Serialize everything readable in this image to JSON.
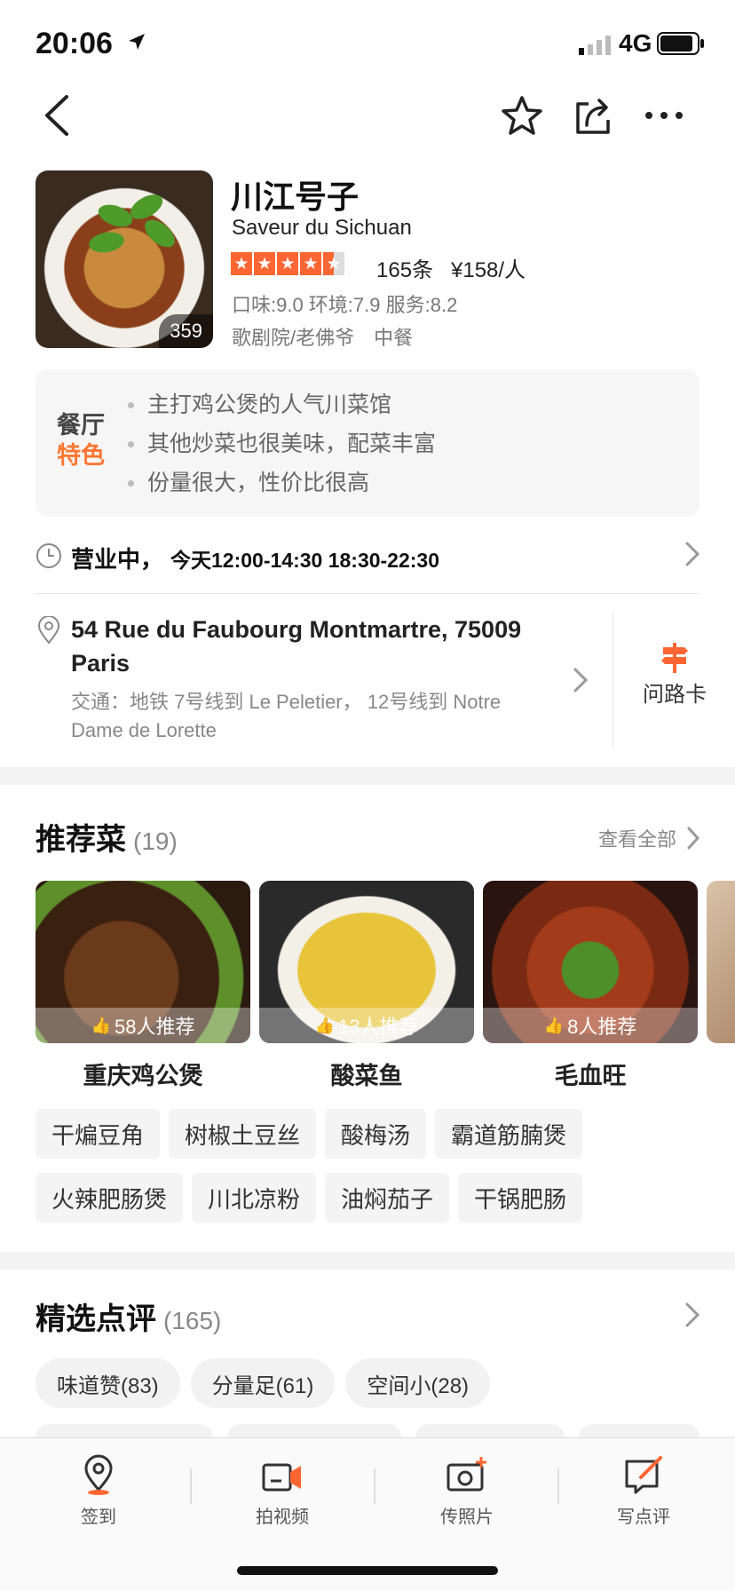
{
  "status_bar": {
    "time": "20:06",
    "network": "4G"
  },
  "shop": {
    "name": "川江号子",
    "subtitle": "Saveur du Sichuan",
    "rating_stars": 4.5,
    "review_count": "165条",
    "price": "¥158/人",
    "scores": "口味:9.0 环境:7.9 服务:8.2",
    "district": "歌剧院/老佛爷",
    "cuisine": "中餐",
    "photo_count": "359"
  },
  "features": {
    "label_line1": "餐厅",
    "label_line2": "特色",
    "items": [
      "主打鸡公煲的人气川菜馆",
      "其他炒菜也很美味，配菜丰富",
      "份量很大，性价比很高"
    ]
  },
  "hours": {
    "status": "营业中，",
    "times": "今天12:00-14:30 18:30-22:30"
  },
  "address": {
    "line": "54 Rue du Faubourg Montmartre, 75009 Paris",
    "traffic": "交通：地铁 7号线到 Le Peletier， 12号线到 Notre Dame de Lorette",
    "route_card": "问路卡"
  },
  "recommended": {
    "title": "推荐菜",
    "count": "(19)",
    "see_all": "查看全部",
    "dishes": [
      {
        "name": "重庆鸡公煲",
        "recommend": "58人推荐"
      },
      {
        "name": "酸菜鱼",
        "recommend": "13人推荐"
      },
      {
        "name": "毛血旺",
        "recommend": "8人推荐"
      }
    ],
    "tags_row1": [
      "干煸豆角",
      "树椒土豆丝",
      "酸梅汤",
      "霸道筋腩煲"
    ],
    "tags_row2": [
      "火辣肥肠煲",
      "川北凉粉",
      "油焖茄子",
      "干锅肥肠"
    ]
  },
  "reviews": {
    "title": "精选点评",
    "count": "(165)",
    "tags": [
      "味道赞(83)",
      "分量足(61)",
      "空间小(28)"
    ]
  },
  "tabbar": {
    "items": [
      {
        "label": "签到",
        "icon": "location-pin-icon"
      },
      {
        "label": "拍视频",
        "icon": "video-camera-icon"
      },
      {
        "label": "传照片",
        "icon": "photo-upload-icon"
      },
      {
        "label": "写点评",
        "icon": "write-review-icon"
      }
    ]
  },
  "colors": {
    "accent": "#ff6633",
    "feature_orange": "#ff7733",
    "band": "#f4f4f4"
  }
}
